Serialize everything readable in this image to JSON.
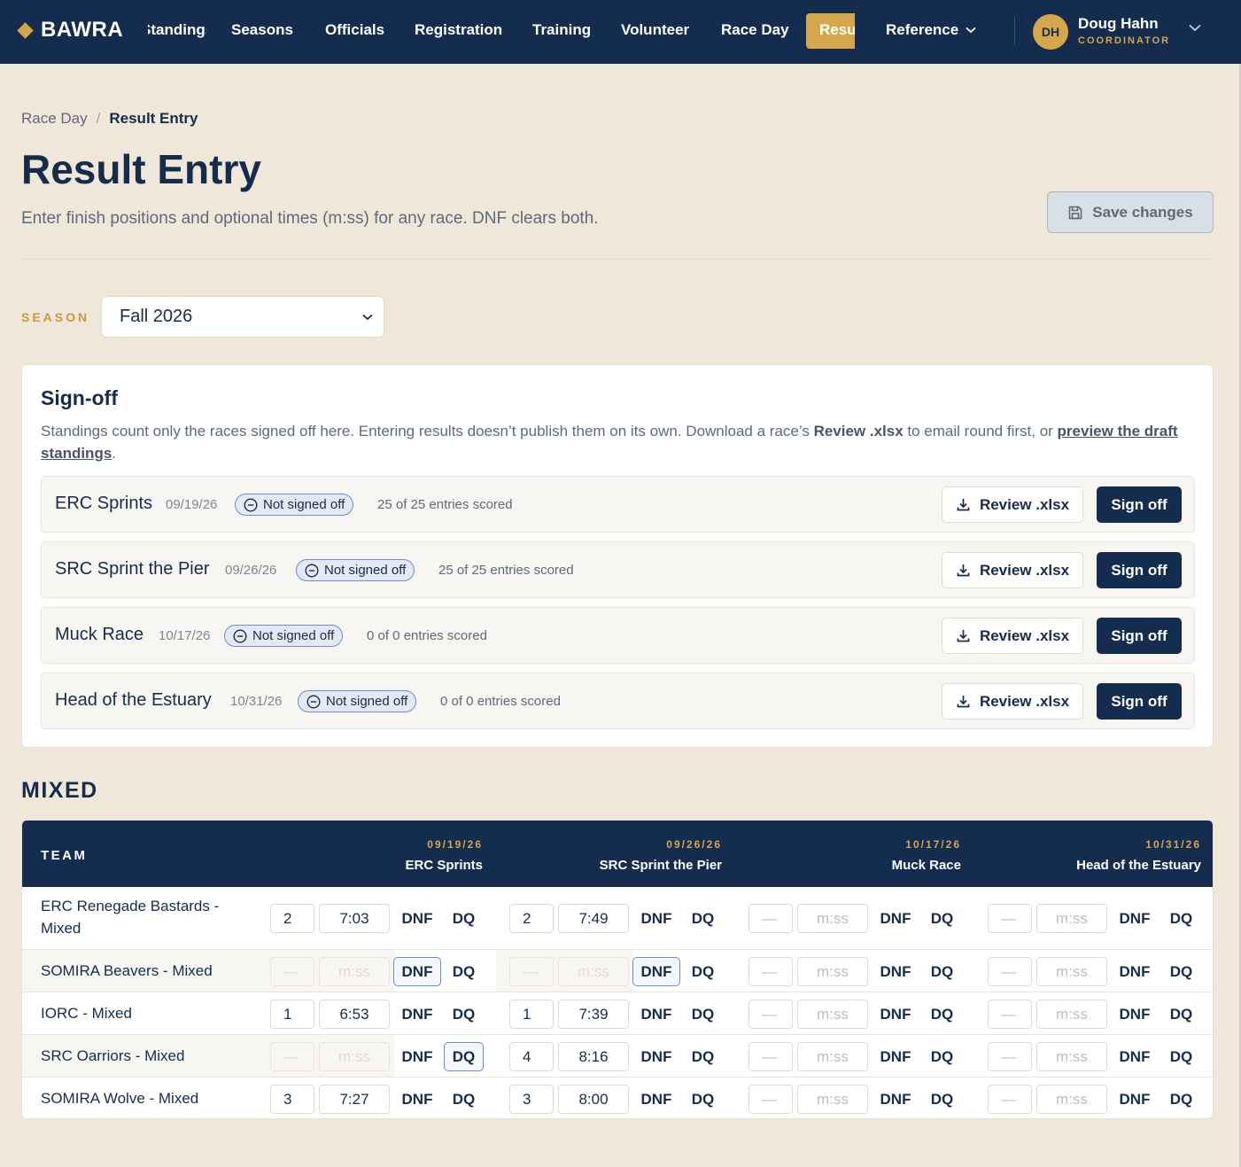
{
  "nav": {
    "brand": "BAWRA",
    "items_clipped_first": "Standings",
    "items": [
      "Seasons",
      "Officials",
      "Registration",
      "Training",
      "Volunteer",
      "Race Day"
    ],
    "active": "Results",
    "reference": "Reference",
    "user": {
      "initials": "DH",
      "name": "Doug Hahn",
      "role": "COORDINATOR"
    }
  },
  "breadcrumb": {
    "parent": "Race Day",
    "separator": "/",
    "current": "Result Entry"
  },
  "page": {
    "title": "Result Entry",
    "subtitle": "Enter finish positions and optional times (m:ss) for any race. DNF clears both.",
    "save_label": "Save changes"
  },
  "season": {
    "label": "SEASON",
    "value": "Fall 2026"
  },
  "signoff": {
    "title": "Sign-off",
    "desc_1": "Standings count only the races signed off here. Entering results doesn’t publish them on its own. Download a race’s ",
    "desc_bold": "Review .xlsx",
    "desc_2": " to email round first, or ",
    "desc_link": "preview the draft standings",
    "desc_end": ".",
    "review_label": "Review .xlsx",
    "signoff_label": "Sign off",
    "races": [
      {
        "name": "ERC Sprints",
        "date": "09/19/26",
        "status": "Not signed off",
        "count": "25 of 25 entries scored"
      },
      {
        "name": "SRC Sprint the Pier",
        "date": "09/26/26",
        "status": "Not signed off",
        "count": "25 of 25 entries scored"
      },
      {
        "name": "Muck Race",
        "date": "10/17/26",
        "status": "Not signed off",
        "count": "0 of 0 entries scored"
      },
      {
        "name": "Head of the Estuary",
        "date": "10/31/26",
        "status": "Not signed off",
        "count": "0 of 0 entries scored"
      }
    ]
  },
  "mixed": {
    "title": "MIXED",
    "team_header": "TEAM",
    "races": [
      {
        "date": "09/19/26",
        "name": "ERC Sprints"
      },
      {
        "date": "09/26/26",
        "name": "SRC Sprint the Pier"
      },
      {
        "date": "10/17/26",
        "name": "Muck Race"
      },
      {
        "date": "10/31/26",
        "name": "Head of the Estuary"
      }
    ],
    "dnf_label": "DNF",
    "dq_label": "DQ",
    "pos_placeholder": "—",
    "time_placeholder": "m:ss",
    "rows": [
      {
        "team": "ERC Renegade Bastards - Mixed",
        "cells": [
          {
            "pos": "2",
            "time": "7:03",
            "state": ""
          },
          {
            "pos": "2",
            "time": "7:49",
            "state": ""
          },
          {
            "pos": "",
            "time": "",
            "state": ""
          },
          {
            "pos": "",
            "time": "",
            "state": ""
          }
        ]
      },
      {
        "team": "SOMIRA Beavers - Mixed",
        "cells": [
          {
            "pos": "",
            "time": "",
            "state": "DNF"
          },
          {
            "pos": "",
            "time": "",
            "state": "DNF"
          },
          {
            "pos": "",
            "time": "",
            "state": ""
          },
          {
            "pos": "",
            "time": "",
            "state": ""
          }
        ]
      },
      {
        "team": "IORC - Mixed",
        "cells": [
          {
            "pos": "1",
            "time": "6:53",
            "state": ""
          },
          {
            "pos": "1",
            "time": "7:39",
            "state": ""
          },
          {
            "pos": "",
            "time": "",
            "state": ""
          },
          {
            "pos": "",
            "time": "",
            "state": ""
          }
        ]
      },
      {
        "team": "SRC Oarriors - Mixed",
        "cells": [
          {
            "pos": "",
            "time": "",
            "state": "DQ"
          },
          {
            "pos": "4",
            "time": "8:16",
            "state": ""
          },
          {
            "pos": "",
            "time": "",
            "state": ""
          },
          {
            "pos": "",
            "time": "",
            "state": ""
          }
        ]
      },
      {
        "team": "SOMIRA Wolve - Mixed",
        "cells": [
          {
            "pos": "3",
            "time": "7:27",
            "state": ""
          },
          {
            "pos": "3",
            "time": "8:00",
            "state": ""
          },
          {
            "pos": "",
            "time": "",
            "state": ""
          },
          {
            "pos": "",
            "time": "",
            "state": ""
          }
        ]
      }
    ]
  },
  "colors": {
    "navy": "#142c4e",
    "gold": "#d6a64d",
    "background": "#efe7da"
  }
}
